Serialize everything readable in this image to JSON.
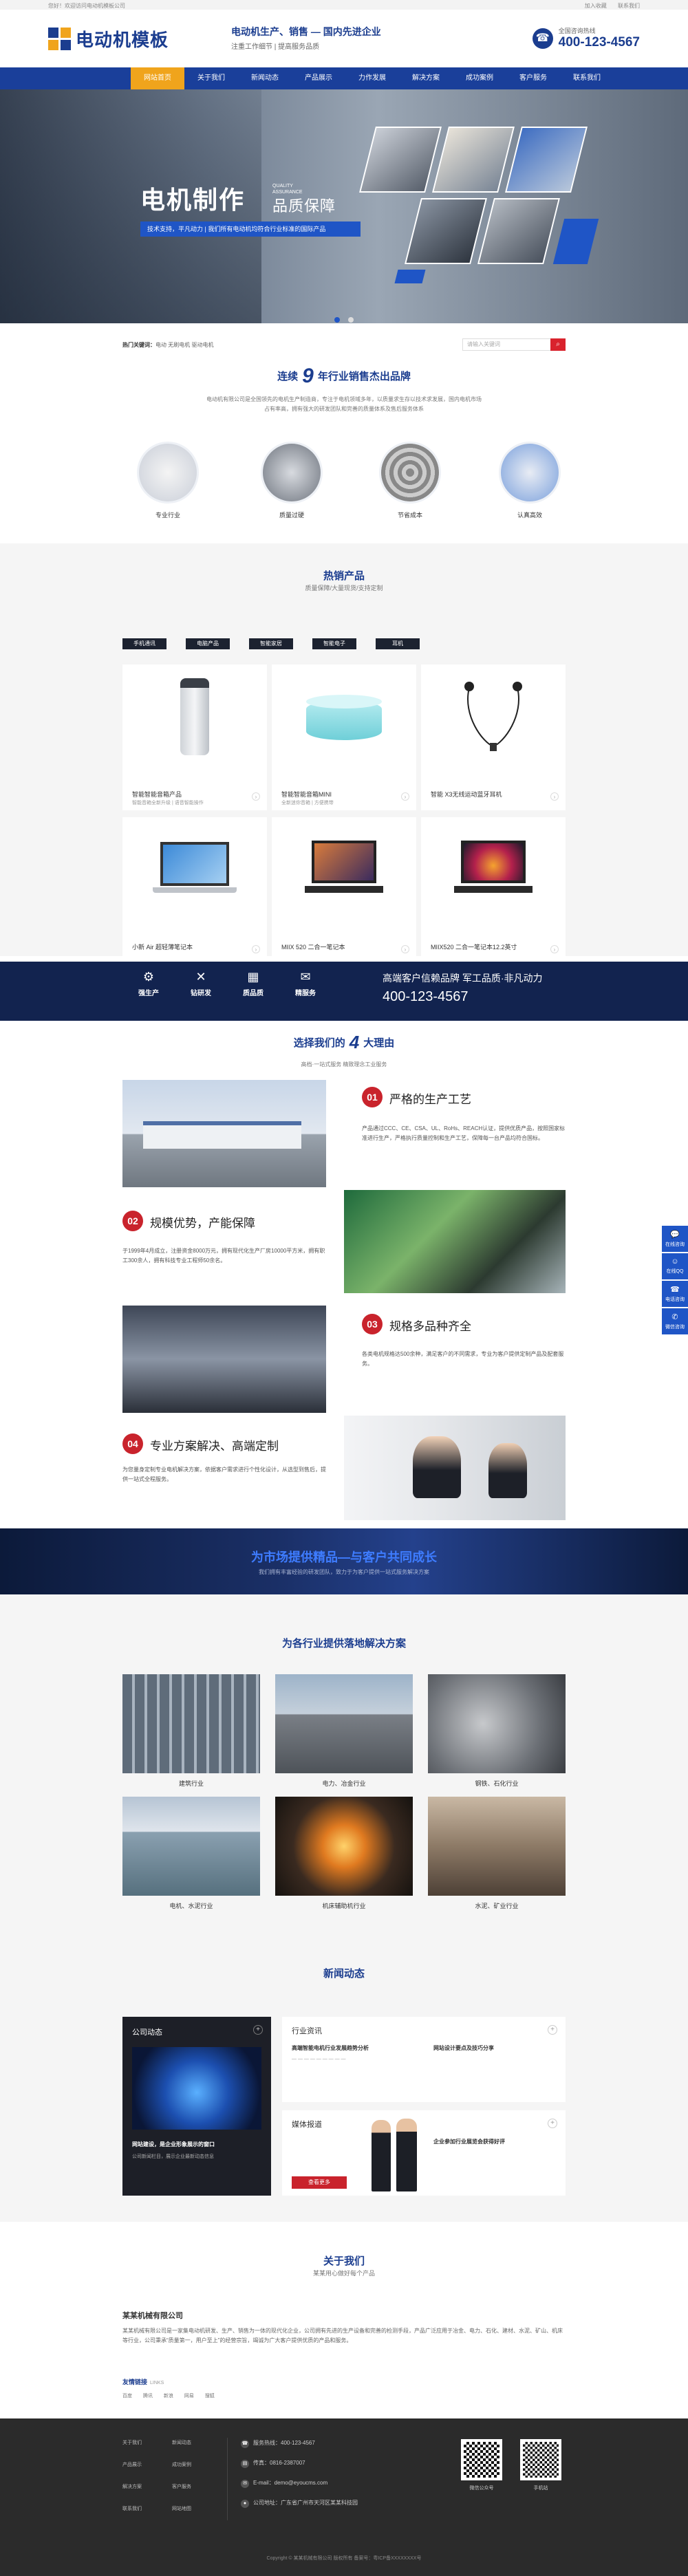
{
  "topbar": {
    "left": "您好！欢迎访问电动机模板公司",
    "links": [
      "加入收藏",
      "联系我们"
    ]
  },
  "header": {
    "logo_text": "电动机模板",
    "slogan_main": "电动机生产、销售 — 国内先进企业",
    "slogan_line1": "注重工作细节",
    "slogan_line2": "提高服务品质",
    "hotline_label": "全国咨询热线",
    "hotline_number": "400-123-4567"
  },
  "nav": [
    "网站首页",
    "关于我们",
    "新闻动态",
    "产品展示",
    "力作发展",
    "解决方案",
    "成功案例",
    "客户服务",
    "联系我们"
  ],
  "banner": {
    "title": "电机制作",
    "qa": "QUALITY\nASSURANCE",
    "subtitle": "品质保障",
    "bar": "技术支持，平凡动力 | 我们所有电动机均符合行业标准的国际产品"
  },
  "crumb": {
    "label": "热门关键词：",
    "keywords": "电动  无刷电机  驱动电机",
    "search_placeholder": "请输入关键词"
  },
  "intro": {
    "pre": "连续",
    "num": "9",
    "post": "年行业销售杰出品牌",
    "desc": "电动机有限公司是全国领先的电机生产制造商，专注于电机领域多年，以质量求生存以技术求发展，国内电机市场占有率高，拥有强大的研发团队和完善的质量体系及售后服务体系",
    "features": [
      "专业行业",
      "质量过硬",
      "节省成本",
      "认真高效"
    ]
  },
  "hot": {
    "title": "热销产品",
    "subtitle": "质量保障/大量现货/支持定制",
    "tabs": [
      "手机通讯",
      "电脑产品",
      "智能家居",
      "智能电子",
      "耳机"
    ],
    "products": [
      {
        "name": "智能智能音箱产品",
        "desc": "智能音箱全新升级 | 语音智能操作"
      },
      {
        "name": "智能智能音箱MINI",
        "desc": "全新迷你音箱 | 方便携带"
      },
      {
        "name": "智能 X3无线运动蓝牙耳机",
        "desc": ""
      },
      {
        "name": "小新 Air 超轻薄笔记本",
        "desc": ""
      },
      {
        "name": "MIIX 520 二合一笔记本",
        "desc": ""
      },
      {
        "name": "MIIX520 二合一笔记本12.2英寸",
        "desc": ""
      }
    ]
  },
  "svc": {
    "items": [
      "强生产",
      "钻研发",
      "质品质",
      "精服务"
    ],
    "slogan": "高端客户信赖品牌 军工品质·非凡动力",
    "phone": "400-123-4567"
  },
  "choose": {
    "pre": "选择我们的",
    "num": "4",
    "post": "大理由",
    "sub": "高档·一站式服务 精致理念工业服务",
    "items": [
      {
        "n": "01",
        "h": "严格的生产工艺",
        "p": "产品通过CCC、CE、CSA、UL、RoHs、REACH认证，提供优质产品，按照国家标准进行生产，严格执行质量控制和生产工艺，保障每一台产品均符合国标。"
      },
      {
        "n": "02",
        "h": "规模优势，产能保障",
        "p": "于1999年4月成立，注册资金8000万元，拥有现代化生产厂房10000平方米，拥有职工300余人，拥有科技专业工程师50余名。"
      },
      {
        "n": "03",
        "h": "规格多品种齐全",
        "p": "各类电机规格达500余种，满足客户的不同需求，专业为客户提供定制产品及配套服务。"
      },
      {
        "n": "04",
        "h": "专业方案解决、高端定制",
        "p": "为您量身定制专业电机解决方案，依据客户需求进行个性化设计，从选型到售后，提供一站式全程服务。"
      }
    ]
  },
  "b2": {
    "title": "为市场提供精品—与客户共同成长",
    "sub": "我们拥有丰富经验的研发团队，致力于为客户提供一站式服务解决方案"
  },
  "ind": {
    "title": "为各行业提供落地解决方案",
    "items": [
      "建筑行业",
      "电力、冶金行业",
      "钢铁、石化行业",
      "电机、水泥行业",
      "机床辅助机行业",
      "水泥、矿业行业"
    ]
  },
  "news": {
    "title": "新闻动态",
    "dark_head": "公司动态",
    "dark_item": "网站建设，是企业形象展示的窗口",
    "dark_desc": "公司新闻栏目，展示企业最新动态信息",
    "cards": [
      {
        "head": "行业资讯",
        "t1": "高端智能电机行业发展趋势分析",
        "t2": "网站设计要点及技巧分享"
      },
      {
        "head": "媒体报道",
        "t1": "企业参加行业展览会获得好评",
        "t2": ""
      }
    ],
    "more": "查看更多"
  },
  "about": {
    "title": "关于我们",
    "sub": "某某用心做好每个产品",
    "company": "某某机械有限公司",
    "desc": "某某机械有限公司是一家集电动机研发、生产、销售为一体的现代化企业，公司拥有先进的生产设备和完善的检测手段，产品广泛应用于冶金、电力、石化、建材、水泥、矿山、机床等行业，公司秉承“质量第一，用户至上”的经营宗旨，竭诚为广大客户提供优质的产品和服务。"
  },
  "links": {
    "label": "友情链接",
    "en": "LINKS",
    "items": [
      "百度",
      "腾讯",
      "新浪",
      "网易",
      "搜狐"
    ]
  },
  "footer": {
    "col1": [
      "关于我们",
      "产品展示",
      "解决方案",
      "联系我们"
    ],
    "col2": [
      "新闻动态",
      "成功案例",
      "客户服务",
      "网站地图"
    ],
    "contact": [
      {
        "icon": "phone-icon",
        "label": "服务热线：400-123-4567"
      },
      {
        "icon": "fax-icon",
        "label": "传真：0816-2387007"
      },
      {
        "icon": "email-icon",
        "label": "E-mail：demo@eyoucms.com"
      },
      {
        "icon": "location-icon",
        "label": "公司地址：广东省广州市天河区某某科技园"
      }
    ],
    "qr": [
      "微信公众号",
      "手机站"
    ],
    "copyright": "Copyright © 某某机械有限公司 版权所有 备案号：粤ICP备XXXXXXXX号"
  },
  "side": [
    "在线咨询",
    "在线QQ",
    "电话咨询",
    "微信咨询"
  ],
  "colors": {
    "primary": "#1a3f9a",
    "accent": "#f0a41c",
    "red": "#c9232c",
    "dark": "#12234f"
  }
}
